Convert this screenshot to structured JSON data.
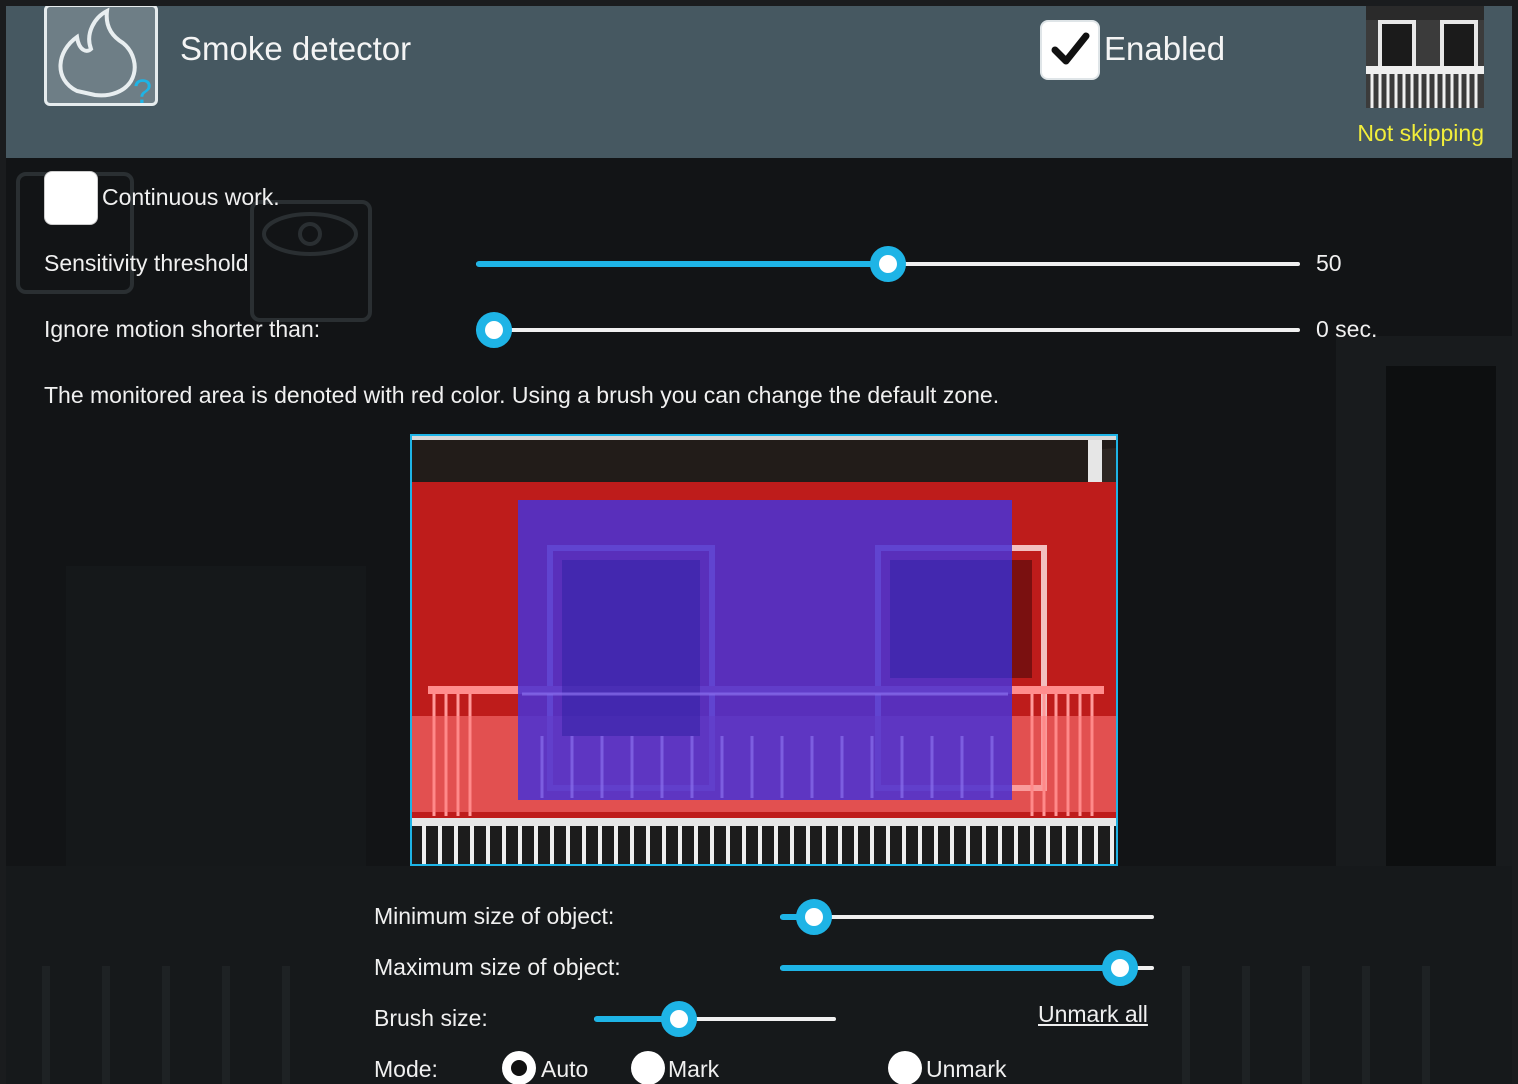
{
  "header": {
    "title": "Smoke detector",
    "enabled_label": "Enabled",
    "enabled_checked": true,
    "skip_status": "Not skipping",
    "skip_status_color": "#f2ee3a"
  },
  "settings": {
    "continuous_label": "Continuous work.",
    "continuous_checked": false,
    "sensitivity_label": "Sensitivity threshold",
    "sensitivity_value": "50",
    "sensitivity_fraction": 0.5,
    "ignore_label": "Ignore motion shorter than:",
    "ignore_value": "0 sec.",
    "ignore_fraction": 0.0
  },
  "zone": {
    "description": "The monitored area is denoted with red color. Using a brush you can change the default zone.",
    "monitored_color": "#d01818",
    "object_color": "#4b32d2"
  },
  "object_size": {
    "min_label": "Minimum size of object:",
    "min_fraction": 0.09,
    "max_label": "Maximum size of object:",
    "max_fraction": 0.91
  },
  "brush": {
    "label": "Brush size:",
    "fraction": 0.35,
    "unmark_all_label": "Unmark all"
  },
  "mode": {
    "label": "Mode:",
    "options": [
      {
        "label": "Auto",
        "selected": true
      },
      {
        "label": "Mark",
        "selected": false
      },
      {
        "label": "Unmark",
        "selected": false
      }
    ]
  },
  "accent_color": "#1eb4e6",
  "header_color": "#465861"
}
